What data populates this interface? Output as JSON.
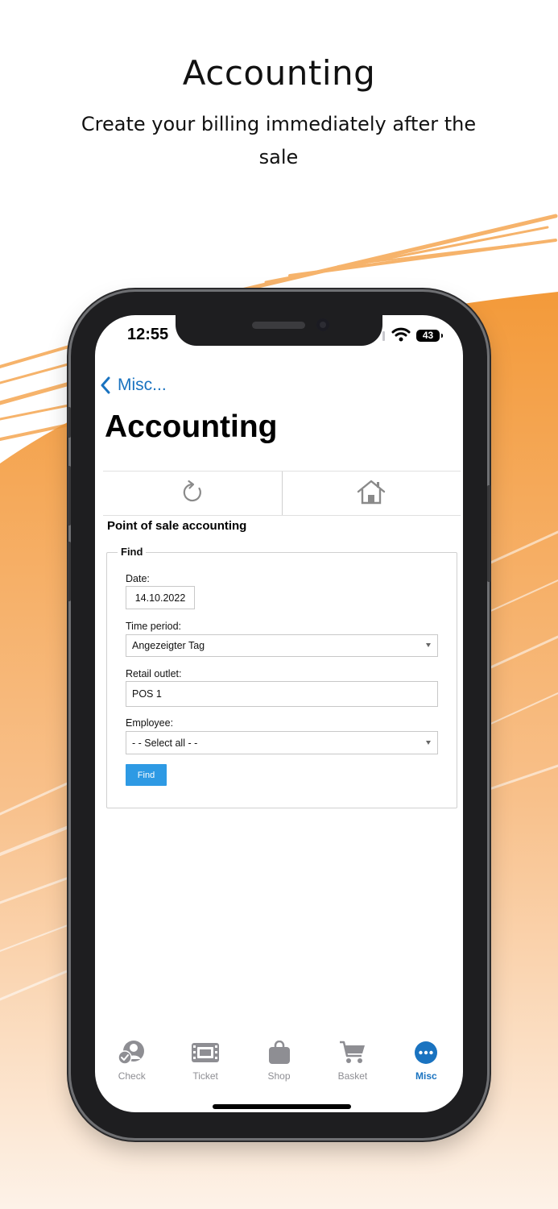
{
  "promo": {
    "title": "Accounting",
    "subtitle": "Create your billing immediately after the sale"
  },
  "status_bar": {
    "time": "12:55",
    "battery": "43"
  },
  "navigation": {
    "back_label": "Misc...",
    "title": "Accounting"
  },
  "toolbar": {
    "refresh_icon": "refresh-icon",
    "home_icon": "home-icon"
  },
  "form": {
    "section_title": "Point of sale accounting",
    "fieldset_legend": "Find",
    "date_label": "Date:",
    "date_value": "14.10.2022",
    "time_period_label": "Time period:",
    "time_period_value": "Angezeigter Tag",
    "retail_outlet_label": "Retail outlet:",
    "retail_outlet_value": "POS 1",
    "employee_label": "Employee:",
    "employee_value": "- - Select all - -",
    "find_button": "Find"
  },
  "tabbar": {
    "items": [
      {
        "label": "Check",
        "icon": "check-user-icon",
        "active": false
      },
      {
        "label": "Ticket",
        "icon": "ticket-icon",
        "active": false
      },
      {
        "label": "Shop",
        "icon": "shopping-bag-icon",
        "active": false
      },
      {
        "label": "Basket",
        "icon": "cart-icon",
        "active": false
      },
      {
        "label": "Misc",
        "icon": "more-icon",
        "active": true
      }
    ]
  },
  "colors": {
    "accent": "#1a73c0",
    "button": "#2e9ae4",
    "brush": "#f39a3a",
    "inactive_tab": "#8e8e93"
  }
}
